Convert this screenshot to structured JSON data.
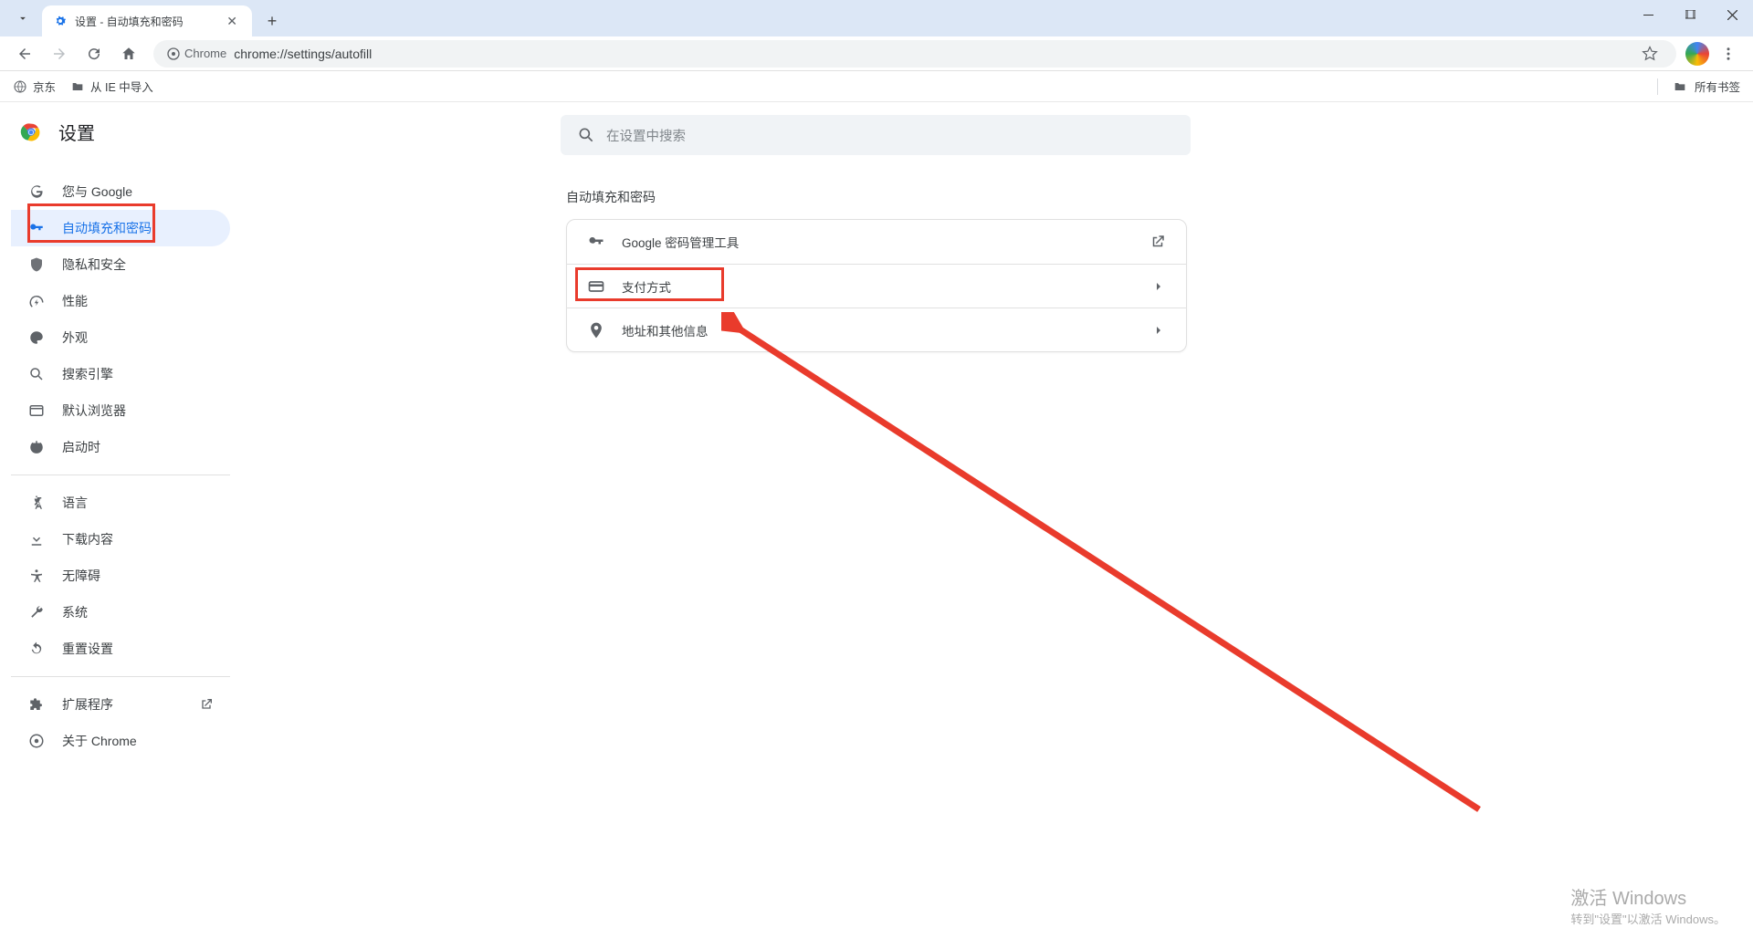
{
  "window": {
    "tab_title": "设置 - 自动填充和密码"
  },
  "toolbar": {
    "chrome_label": "Chrome",
    "url": "chrome://settings/autofill"
  },
  "bookmarks": {
    "jd": "京东",
    "ie_import": "从 IE 中导入",
    "all": "所有书签"
  },
  "settings": {
    "title": "设置"
  },
  "search": {
    "placeholder": "在设置中搜索"
  },
  "sidebar": {
    "items": [
      {
        "label": "您与 Google"
      },
      {
        "label": "自动填充和密码"
      },
      {
        "label": "隐私和安全"
      },
      {
        "label": "性能"
      },
      {
        "label": "外观"
      },
      {
        "label": "搜索引擎"
      },
      {
        "label": "默认浏览器"
      },
      {
        "label": "启动时"
      }
    ],
    "items2": [
      {
        "label": "语言"
      },
      {
        "label": "下载内容"
      },
      {
        "label": "无障碍"
      },
      {
        "label": "系统"
      },
      {
        "label": "重置设置"
      }
    ],
    "items3": [
      {
        "label": "扩展程序"
      },
      {
        "label": "关于 Chrome"
      }
    ]
  },
  "main": {
    "section_title": "自动填充和密码",
    "rows": [
      {
        "label": "Google 密码管理工具"
      },
      {
        "label": "支付方式"
      },
      {
        "label": "地址和其他信息"
      }
    ]
  },
  "watermark": {
    "line1": "激活 Windows",
    "line2": "转到\"设置\"以激活 Windows。"
  }
}
